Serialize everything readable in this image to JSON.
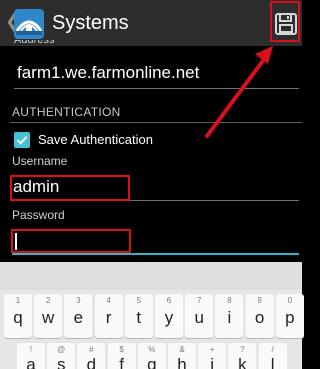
{
  "actionbar": {
    "title": "Systems",
    "icons": {
      "back": "chevron-left-icon",
      "app": "farm-logo-icon",
      "save": "floppy-disk-icon"
    }
  },
  "form": {
    "address_label": "Address",
    "address_value": "farm1.we.farmonline.net",
    "section_header": "AUTHENTICATION",
    "save_auth_label": "Save Authentication",
    "save_auth_checked": true,
    "username_label": "Username",
    "username_value": "admin",
    "password_label": "Password",
    "password_value": ""
  },
  "keyboard": {
    "row1": [
      {
        "char": "q",
        "hint": "1"
      },
      {
        "char": "w",
        "hint": "2"
      },
      {
        "char": "e",
        "hint": "3"
      },
      {
        "char": "r",
        "hint": "4"
      },
      {
        "char": "t",
        "hint": "5"
      },
      {
        "char": "y",
        "hint": "6"
      },
      {
        "char": "u",
        "hint": "7"
      },
      {
        "char": "i",
        "hint": "8"
      },
      {
        "char": "o",
        "hint": "9"
      },
      {
        "char": "p",
        "hint": "0"
      }
    ],
    "row2": [
      {
        "char": "a",
        "hint": "!"
      },
      {
        "char": "s",
        "hint": "@"
      },
      {
        "char": "d",
        "hint": "#"
      },
      {
        "char": "f",
        "hint": "$"
      },
      {
        "char": "g",
        "hint": "%"
      },
      {
        "char": "h",
        "hint": "&"
      },
      {
        "char": "j",
        "hint": "+"
      },
      {
        "char": "k",
        "hint": "?"
      },
      {
        "char": "l",
        "hint": "/"
      }
    ]
  },
  "colors": {
    "accent": "#2bb7c9",
    "annotation": "#d8101b",
    "actionbar": "#2d2d2d"
  }
}
